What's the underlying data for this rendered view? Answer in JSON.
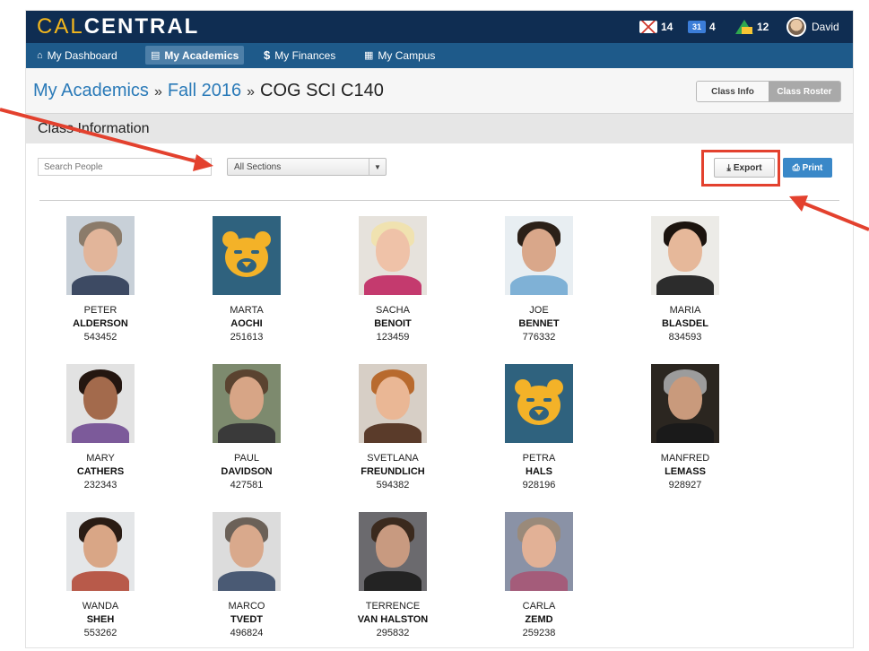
{
  "header": {
    "logo_cal": "CAL",
    "logo_central": "CENTRAL",
    "mail_count": "14",
    "calendar_day": "31",
    "calendar_count": "4",
    "drive_count": "12",
    "user_name": "David"
  },
  "nav": {
    "items": [
      {
        "label": "My Dashboard",
        "icon": "home-icon"
      },
      {
        "label": "My Academics",
        "icon": "book-icon"
      },
      {
        "label": "My Finances",
        "icon": "dollar-icon"
      },
      {
        "label": "My Campus",
        "icon": "grid-icon"
      }
    ]
  },
  "breadcrumb": {
    "root": "My Academics",
    "term": "Fall 2016",
    "course": "COG SCI C140",
    "separator": "»"
  },
  "view_toggle": {
    "class_info": "Class Info",
    "class_roster": "Class Roster"
  },
  "section": {
    "title": "Class Information"
  },
  "controls": {
    "search_placeholder": "Search People",
    "section_select": "All Sections",
    "export_label": "Export",
    "print_label": "Print"
  },
  "roster": [
    {
      "first": "PETER",
      "last": "ALDERSON",
      "id": "543452",
      "photo": "skin:#e2b59a;hair:#8b7b6a;shirt:#3d4a63;bg:#c8d0d8"
    },
    {
      "first": "MARTA",
      "last": "AOCHI",
      "id": "251613",
      "photo": "bear"
    },
    {
      "first": "SACHA",
      "last": "BENOIT",
      "id": "123459",
      "photo": "skin:#efc2a8;hair:#f0e2b0;shirt:#c43a6e;bg:#e6e2dc"
    },
    {
      "first": "JOE",
      "last": "BENNET",
      "id": "776332",
      "photo": "skin:#d9a78a;hair:#2b2018;shirt:#7fb1d6;bg:#e8eef2"
    },
    {
      "first": "MARIA",
      "last": "BLASDEL",
      "id": "834593",
      "photo": "skin:#e6b89a;hair:#1c140f;shirt:#2c2c2c;bg:#ecebe7"
    },
    {
      "first": "MARY",
      "last": "CATHERS",
      "id": "232343",
      "photo": "skin:#a36a4c;hair:#241610;shirt:#7c5a9a;bg:#e2e2e2"
    },
    {
      "first": "PAUL",
      "last": "DAVIDSON",
      "id": "427581",
      "photo": "skin:#d7a586;hair:#5a4330;shirt:#3a3a3a;bg:#7d8a6e"
    },
    {
      "first": "SVETLANA",
      "last": "FREUNDLICH",
      "id": "594382",
      "photo": "skin:#eab795;hair:#b86a2e;shirt:#5a3b2a;bg:#d7cfc6"
    },
    {
      "first": "PETRA",
      "last": "HALS",
      "id": "928196",
      "photo": "bear"
    },
    {
      "first": "MANFRED",
      "last": "LEMASS",
      "id": "928927",
      "photo": "skin:#c99a7c;hair:#9c9c9c;shirt:#1a1a1a;bg:#2b2620"
    },
    {
      "first": "WANDA",
      "last": "SHEH",
      "id": "553262",
      "photo": "skin:#d9a686;hair:#2a1c14;shirt:#b85a4a;bg:#e4e6e8"
    },
    {
      "first": "MARCO",
      "last": "TVEDT",
      "id": "496824",
      "photo": "skin:#d9a98c;hair:#6b6158;shirt:#4a5a74;bg:#dcdcdc"
    },
    {
      "first": "TERRENCE",
      "last": "VAN HALSTON",
      "id": "295832",
      "photo": "skin:#c89a80;hair:#3b2a1e;shirt:#232323;bg:#6b6a6e"
    },
    {
      "first": "CARLA",
      "last": "ZEMD",
      "id": "259238",
      "photo": "skin:#e2b196;hair:#9a8a7a;shirt:#a45c7a;bg:#8a92a6"
    }
  ],
  "colors": {
    "header_bg": "#0f2d52",
    "nav_bg": "#1e5a8a",
    "link": "#2a7ab8",
    "highlight": "#e3412e",
    "print_btn": "#3a88c8"
  }
}
